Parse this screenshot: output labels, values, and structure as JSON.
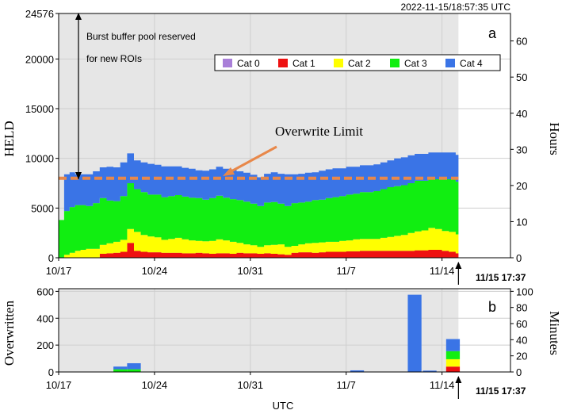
{
  "timestamp": "2022-11-15/18:57:35 UTC",
  "colors": {
    "shade": "#e6e6e6",
    "grid": "#cfcfcf",
    "overwrite_line": "#e8884a",
    "Cat 0": "#a97fd8",
    "Cat 1": "#ee1111",
    "Cat 2": "#ffff00",
    "Cat 3": "#11ee11",
    "Cat 4": "#3a74e6"
  },
  "chart_data": [
    {
      "type": "area",
      "stacked": true,
      "panel_label": "a",
      "ylabel": "HELD",
      "y2label": "Hours",
      "ylim": [
        0,
        24576
      ],
      "y_ticks": [
        "0",
        "5000",
        "10000",
        "15000",
        "20000",
        "24576"
      ],
      "y2lim": [
        0,
        67.6
      ],
      "y2_ticks": [
        "0",
        "10",
        "20",
        "30",
        "40",
        "50",
        "60"
      ],
      "xlim": [
        "10/17",
        "11/19"
      ],
      "x_ticks": [
        "10/17",
        "10/24",
        "10/31",
        "11/7",
        "11/14"
      ],
      "x_days": [
        0,
        7,
        14,
        21,
        28
      ],
      "now_label": "11/15 17:37",
      "now_day": 29.2,
      "overwrite_limit": 8000,
      "overwrite_label": "Overwrite Limit",
      "annotation_lines": [
        "Burst buffer pool reserved",
        "for new ROIs"
      ],
      "legend": [
        "Cat 0",
        "Cat 1",
        "Cat 2",
        "Cat 3",
        "Cat 4"
      ],
      "legend_position": "top-right",
      "days": [
        0,
        0.4,
        0.8,
        1.2,
        1.6,
        2.0,
        2.5,
        3.0,
        3.5,
        4.0,
        4.5,
        5.0,
        5.5,
        6.0,
        6.5,
        7.0,
        7.5,
        8.0,
        8.5,
        9.0,
        9.5,
        10.0,
        10.5,
        11.0,
        11.5,
        12.0,
        12.5,
        13.0,
        13.5,
        14.0,
        14.5,
        15.0,
        15.5,
        16.0,
        16.5,
        17.0,
        17.5,
        18.0,
        18.5,
        19.0,
        19.5,
        20.0,
        20.5,
        21.0,
        21.5,
        22.0,
        22.5,
        23.0,
        23.5,
        24.0,
        24.5,
        25.0,
        25.5,
        26.0,
        26.5,
        27.0,
        27.5,
        28.0,
        28.5,
        29.0,
        29.2
      ],
      "series": [
        {
          "name": "Cat 0",
          "values": [
            0,
            0,
            0,
            0,
            0,
            0,
            0,
            0,
            0,
            0,
            0,
            0,
            0,
            0,
            0,
            0,
            0,
            0,
            0,
            0,
            0,
            0,
            0,
            0,
            0,
            0,
            0,
            0,
            0,
            0,
            0,
            0,
            0,
            0,
            0,
            0,
            0,
            0,
            0,
            0,
            0,
            0,
            0,
            0,
            0,
            0,
            0,
            0,
            0,
            0,
            0,
            0,
            0,
            0,
            0,
            0,
            0,
            0,
            0,
            0,
            0
          ]
        },
        {
          "name": "Cat 1",
          "values": [
            0,
            0,
            0,
            0,
            0,
            0,
            0,
            400,
            450,
            500,
            600,
            1500,
            700,
            600,
            550,
            550,
            500,
            500,
            500,
            450,
            450,
            500,
            450,
            400,
            450,
            450,
            400,
            500,
            450,
            450,
            400,
            450,
            400,
            350,
            300,
            500,
            550,
            550,
            500,
            550,
            600,
            600,
            600,
            650,
            650,
            700,
            700,
            700,
            700,
            700,
            700,
            700,
            700,
            750,
            750,
            800,
            800,
            700,
            600,
            450,
            400
          ]
        },
        {
          "name": "Cat 2",
          "values": [
            0,
            300,
            500,
            700,
            800,
            900,
            900,
            900,
            1000,
            1100,
            1200,
            1400,
            1900,
            1700,
            1600,
            1500,
            1300,
            1400,
            1500,
            1400,
            1300,
            1200,
            1200,
            1300,
            1400,
            1300,
            1200,
            1000,
            900,
            800,
            700,
            800,
            900,
            1000,
            800,
            700,
            800,
            900,
            1000,
            1000,
            1000,
            1000,
            1100,
            1100,
            1200,
            1200,
            1200,
            1200,
            1300,
            1400,
            1500,
            1600,
            1800,
            1900,
            2000,
            2200,
            2100,
            2000,
            2000,
            1900,
            1800
          ]
        },
        {
          "name": "Cat 3",
          "values": [
            3800,
            4400,
            4600,
            4600,
            4500,
            4300,
            4600,
            4700,
            4300,
            4100,
            4400,
            4600,
            4300,
            4300,
            4200,
            4300,
            4300,
            4300,
            4300,
            4300,
            4300,
            4300,
            4200,
            4300,
            4400,
            4300,
            4300,
            4300,
            4300,
            4200,
            4100,
            4300,
            4300,
            4100,
            4100,
            4300,
            4200,
            4200,
            4300,
            4300,
            4400,
            4500,
            4500,
            4600,
            4600,
            4700,
            4700,
            4800,
            4900,
            5000,
            5000,
            5000,
            5000,
            5100,
            5000,
            4900,
            5000,
            5200,
            5300,
            5300,
            5400
          ]
        },
        {
          "name": "Cat 4",
          "values": [
            0,
            3700,
            3500,
            3100,
            3100,
            3200,
            3200,
            3100,
            3400,
            3400,
            3400,
            3000,
            2900,
            3000,
            3100,
            3000,
            3100,
            3000,
            2900,
            2900,
            2900,
            2800,
            2900,
            2900,
            2900,
            2900,
            3000,
            2900,
            2900,
            2900,
            2900,
            2900,
            3000,
            3000,
            3200,
            2900,
            2900,
            2900,
            2800,
            2900,
            2900,
            2900,
            2800,
            2800,
            2700,
            2700,
            2700,
            2700,
            2700,
            2700,
            2800,
            2800,
            2800,
            2700,
            2700,
            2700,
            2700,
            2700,
            2700,
            2700,
            2600
          ]
        }
      ]
    },
    {
      "type": "bar",
      "stacked": true,
      "panel_label": "b",
      "ylabel": "Overwritten",
      "y2label": "Minutes",
      "xlabel": "UTC",
      "ylim": [
        0,
        620
      ],
      "y_ticks": [
        "0",
        "200",
        "400",
        "600"
      ],
      "y2lim": [
        0,
        103.3
      ],
      "y2_ticks": [
        "0",
        "20",
        "40",
        "60",
        "80",
        "100"
      ],
      "xlim": [
        "10/17",
        "11/19"
      ],
      "x_ticks": [
        "10/17",
        "10/24",
        "10/31",
        "11/7",
        "11/14"
      ],
      "x_days": [
        0,
        7,
        14,
        21,
        28
      ],
      "now_label": "11/15 17:37",
      "now_day": 29.2,
      "bar_width_days": 1.0,
      "bars": [
        {
          "day": 4.5,
          "Cat 0": 0,
          "Cat 1": 0,
          "Cat 2": 0,
          "Cat 3": 20,
          "Cat 4": 20
        },
        {
          "day": 5.5,
          "Cat 0": 0,
          "Cat 1": 0,
          "Cat 2": 0,
          "Cat 3": 20,
          "Cat 4": 45
        },
        {
          "day": 21.8,
          "Cat 0": 0,
          "Cat 1": 0,
          "Cat 2": 0,
          "Cat 3": 0,
          "Cat 4": 12
        },
        {
          "day": 26.0,
          "Cat 0": 0,
          "Cat 1": 0,
          "Cat 2": 0,
          "Cat 3": 0,
          "Cat 4": 575
        },
        {
          "day": 27.1,
          "Cat 0": 0,
          "Cat 1": 0,
          "Cat 2": 0,
          "Cat 3": 0,
          "Cat 4": 10
        },
        {
          "day": 28.8,
          "Cat 0": 0,
          "Cat 1": 40,
          "Cat 2": 55,
          "Cat 3": 60,
          "Cat 4": 90
        }
      ]
    }
  ]
}
